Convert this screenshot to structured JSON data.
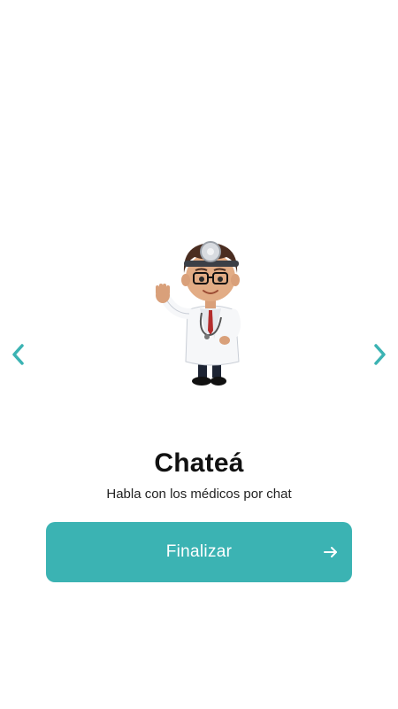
{
  "slide": {
    "title": "Chateá",
    "subtitle": "Habla con los médicos por chat",
    "illustration": "doctor-waving-illustration"
  },
  "navigation": {
    "prev_icon": "chevron-left-icon",
    "next_icon": "chevron-right-icon"
  },
  "finish_button": {
    "label": "Finalizar",
    "icon": "arrow-right-icon"
  },
  "colors": {
    "accent": "#3bb3b3",
    "button_text": "#ffffff",
    "title": "#111111",
    "background": "#ffffff"
  }
}
